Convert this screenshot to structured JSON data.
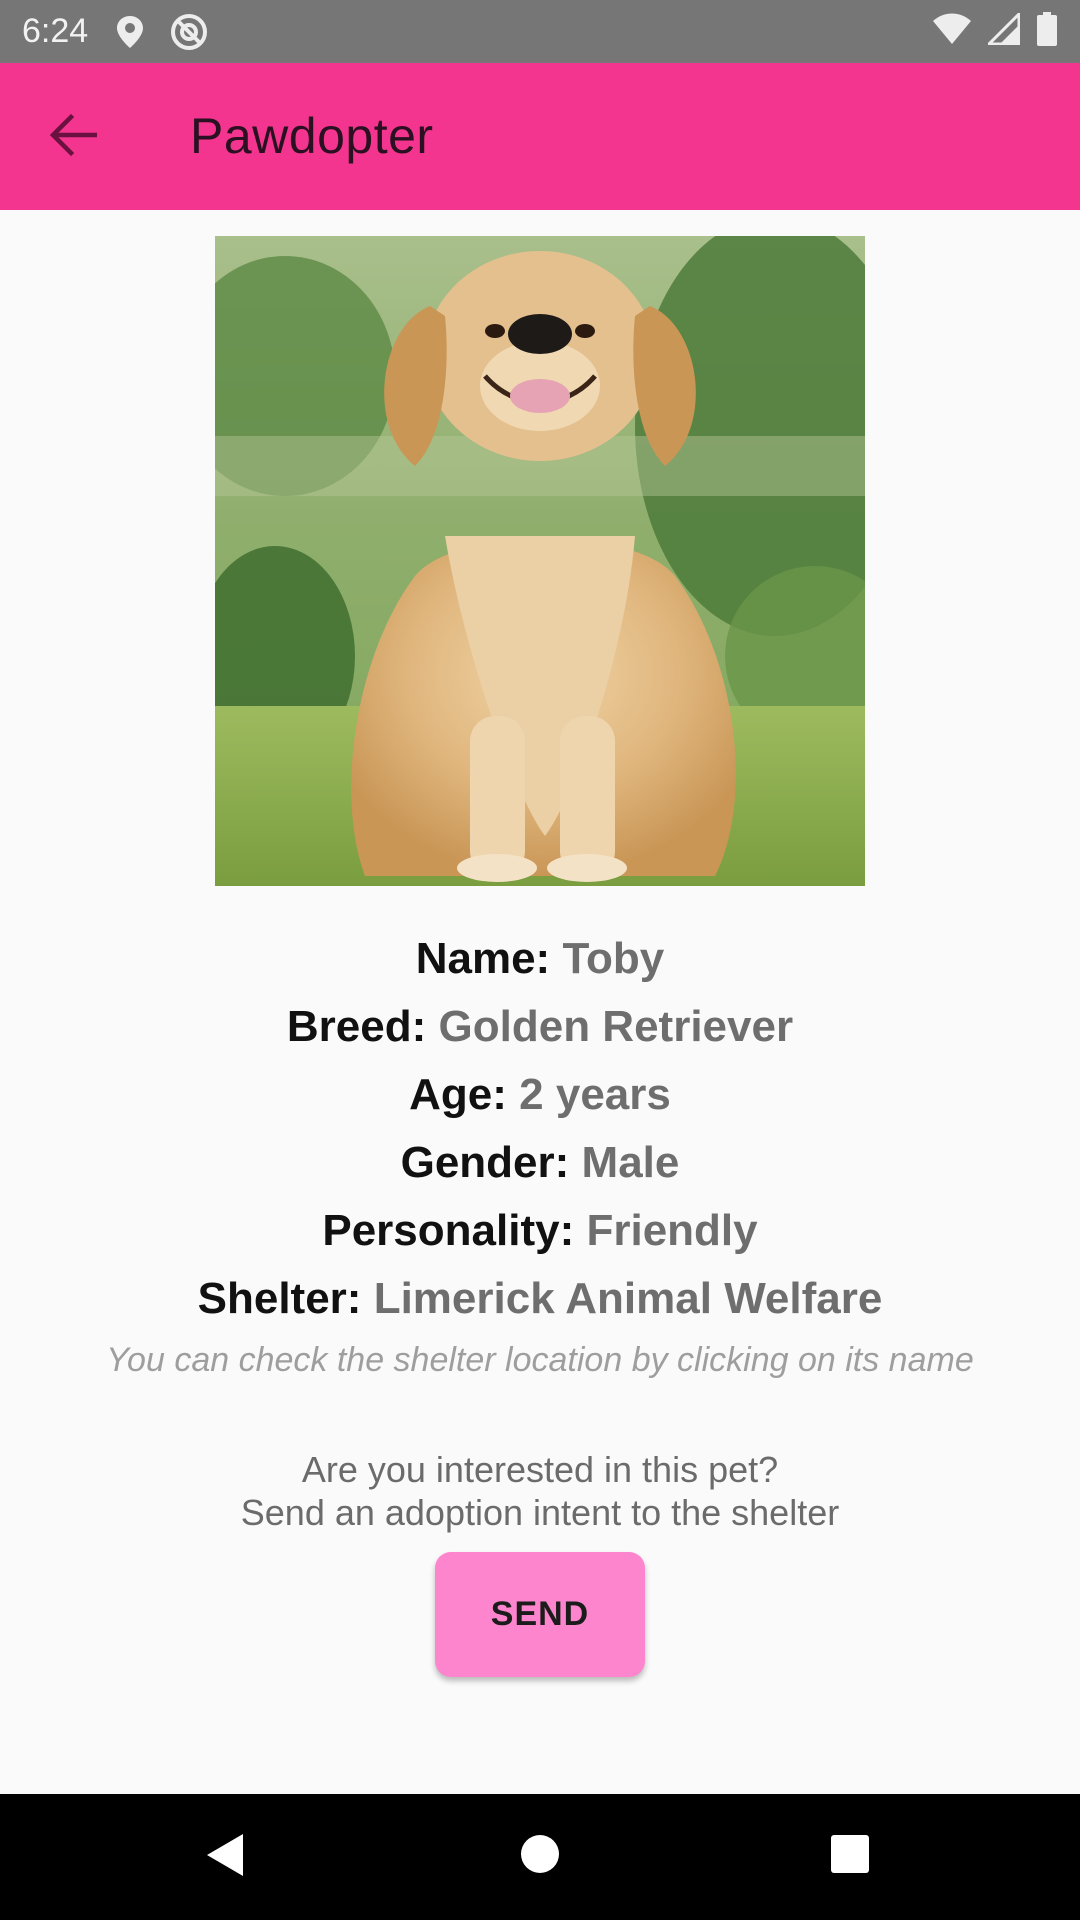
{
  "status_bar": {
    "time": "6:24",
    "icons": [
      "location-icon",
      "at-sign-icon",
      "wifi-icon",
      "signal-icon",
      "battery-icon"
    ]
  },
  "app_bar": {
    "title": "Pawdopter",
    "back_icon": "arrow-back-icon",
    "color": "#f3358f"
  },
  "pet": {
    "photo": "golden-retriever-photo",
    "details": [
      {
        "label": "Name:",
        "value": "Toby"
      },
      {
        "label": "Breed:",
        "value": "Golden Retriever"
      },
      {
        "label": "Age:",
        "value": "2 years"
      },
      {
        "label": "Gender:",
        "value": "Male"
      },
      {
        "label": "Personality:",
        "value": "Friendly"
      },
      {
        "label": "Shelter:",
        "value": "Limerick Animal Welfare"
      }
    ],
    "shelter_hint": "You can check the shelter location by clicking on its name"
  },
  "adoption": {
    "prompt_line1": "Are you interested in this pet?",
    "prompt_line2": "Send an adoption intent to the shelter",
    "send_label": "SEND",
    "button_color": "#fd85cd"
  },
  "nav_bar": {
    "icons": [
      "back-triangle-icon",
      "home-circle-icon",
      "recents-square-icon"
    ]
  }
}
